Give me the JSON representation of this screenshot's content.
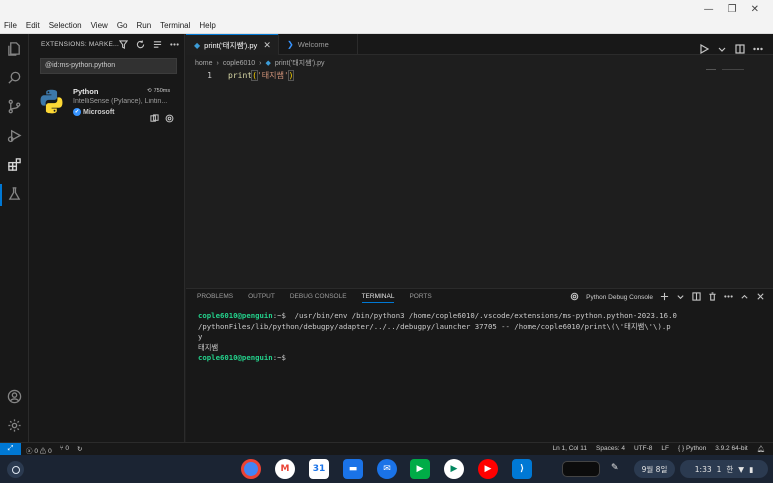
{
  "menubar": {
    "items": [
      "File",
      "Edit",
      "Selection",
      "View",
      "Go",
      "Run",
      "Terminal",
      "Help"
    ],
    "window_controls": [
      "minimize-icon",
      "restore-icon",
      "close-icon"
    ]
  },
  "activity_bar": {
    "icons": [
      "explorer-icon",
      "search-icon",
      "source-control-icon",
      "run-debug-icon",
      "extensions-icon",
      "testing-icon",
      "account-icon",
      "settings-gear-icon"
    ],
    "active": "extensions-icon",
    "accent_color": "#0078d4"
  },
  "sidebar": {
    "title": "EXTENSIONS: MARKE...",
    "search_value": "@id:ms-python.python",
    "extension": {
      "name": "Python",
      "activation_time": "750ms",
      "description": "IntelliSense (Pylance), Lintin...",
      "publisher": "Microsoft"
    }
  },
  "tabs": [
    {
      "label": "print('태지쌤').py",
      "active": true
    },
    {
      "label": "Welcome",
      "active": false
    }
  ],
  "breadcrumb": [
    "home",
    "cople6010",
    "print('태지쌤').py"
  ],
  "editor": {
    "line_number": "1",
    "code_fn": "print",
    "code_open": "(",
    "code_str": "'태지쌤'",
    "code_close": ")"
  },
  "panel": {
    "tabs": [
      "PROBLEMS",
      "OUTPUT",
      "DEBUG CONSOLE",
      "TERMINAL",
      "PORTS"
    ],
    "active_tab": "TERMINAL",
    "debug_console_label": "Python Debug Console",
    "terminal": {
      "user1": "cople6010@penguin",
      "cmd1": ":~$  /usr/bin/env /bin/python3 /home/cople6010/.vscode/extensions/ms-python.python-2023.16.0",
      "line2": "/pythonFiles/lib/python/debugpy/adapter/../../debugpy/launcher 37705 -- /home/cople6010/print\\(\\'태지쌤\\'\\).p",
      "line3": "y",
      "output": "태지쌤",
      "user2": "cople6010@penguin",
      "cmd2": ":~$ "
    }
  },
  "statusbar": {
    "errors": "0",
    "warnings": "0",
    "ports": "0",
    "position": "Ln 1, Col 11",
    "spaces": "Spaces: 4",
    "encoding": "UTF-8",
    "eol": "LF",
    "language": "Python",
    "interpreter": "3.9.2 64-bit"
  },
  "shelf": {
    "apps": [
      {
        "name": "chrome-icon",
        "color": "#4285f4"
      },
      {
        "name": "gmail-icon",
        "color": "#ea4335"
      },
      {
        "name": "calendar-icon",
        "color": "#1a73e8"
      },
      {
        "name": "files-icon",
        "color": "#1a73e8"
      },
      {
        "name": "messages-icon",
        "color": "#1a73e8"
      },
      {
        "name": "meet-icon",
        "color": "#00ac47"
      },
      {
        "name": "play-store-icon",
        "color": "#01875f"
      },
      {
        "name": "youtube-icon",
        "color": "#ff0000"
      },
      {
        "name": "vscode-icon",
        "color": "#0078d4"
      }
    ],
    "date": "9월 8일",
    "time": "1:33",
    "notifications": "1",
    "ime": "한"
  }
}
